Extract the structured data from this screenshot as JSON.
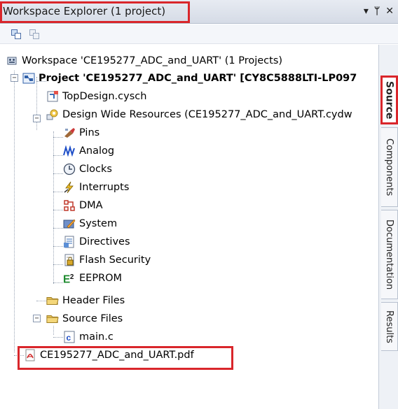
{
  "panel": {
    "title": "Workspace Explorer (1 project)",
    "controls": {
      "dropdown": "▾",
      "pin": "ᛘ",
      "close": "✕"
    }
  },
  "tree": {
    "workspace": "Workspace 'CE195277_ADC_and_UART' (1 Projects)",
    "project": "Project  'CE195277_ADC_and_UART' [CY8C5888LTI-LP097",
    "items": {
      "topdesign": "TopDesign.cysch",
      "dwr": "Design Wide Resources (CE195277_ADC_and_UART.cydw",
      "pins": "Pins",
      "analog": "Analog",
      "clocks": "Clocks",
      "interrupts": "Interrupts",
      "dma": "DMA",
      "system": "System",
      "directives": "Directives",
      "flash_security": "Flash Security",
      "eeprom": "EEPROM",
      "header_files": "Header Files",
      "source_files": "Source Files",
      "main_c": "main.c",
      "pdf": "CE195277_ADC_and_UART.pdf"
    }
  },
  "tabs": [
    "Source",
    "Components",
    "Documentation",
    "Results"
  ],
  "colors": {
    "highlight": "#d9262b"
  }
}
